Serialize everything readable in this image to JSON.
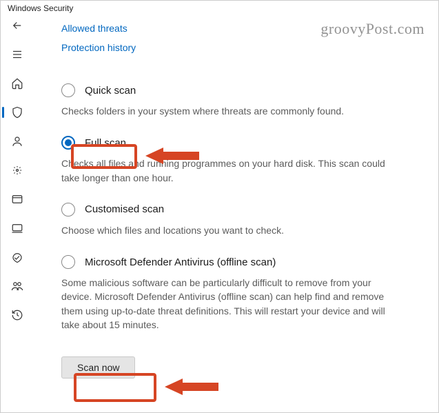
{
  "window": {
    "title": "Windows Security"
  },
  "watermark": "groovyPost.com",
  "links": {
    "allowed_threats": "Allowed threats",
    "protection_history": "Protection history"
  },
  "sidebar": {
    "items": [
      {
        "name": "back-icon"
      },
      {
        "name": "menu-icon"
      },
      {
        "name": "home-icon"
      },
      {
        "name": "shield-icon",
        "active": true
      },
      {
        "name": "account-icon"
      },
      {
        "name": "firewall-icon"
      },
      {
        "name": "app-browser-icon"
      },
      {
        "name": "device-security-icon"
      },
      {
        "name": "performance-icon"
      },
      {
        "name": "family-icon"
      },
      {
        "name": "history-icon"
      }
    ]
  },
  "options": {
    "quick": {
      "label": "Quick scan",
      "desc": "Checks folders in your system where threats are commonly found."
    },
    "full": {
      "label": "Full scan",
      "desc": "Checks all files and running programmes on your hard disk. This scan could take longer than one hour."
    },
    "custom": {
      "label": "Customised scan",
      "desc": "Choose which files and locations you want to check."
    },
    "offline": {
      "label": "Microsoft Defender Antivirus (offline scan)",
      "desc": "Some malicious software can be particularly difficult to remove from your device. Microsoft Defender Antivirus (offline scan) can help find and remove them using up-to-date threat definitions. This will restart your device and will take about 15 minutes."
    }
  },
  "buttons": {
    "scan_now": "Scan now"
  },
  "annotations": {
    "highlight1": "full-scan-highlight",
    "highlight2": "scan-now-highlight"
  }
}
